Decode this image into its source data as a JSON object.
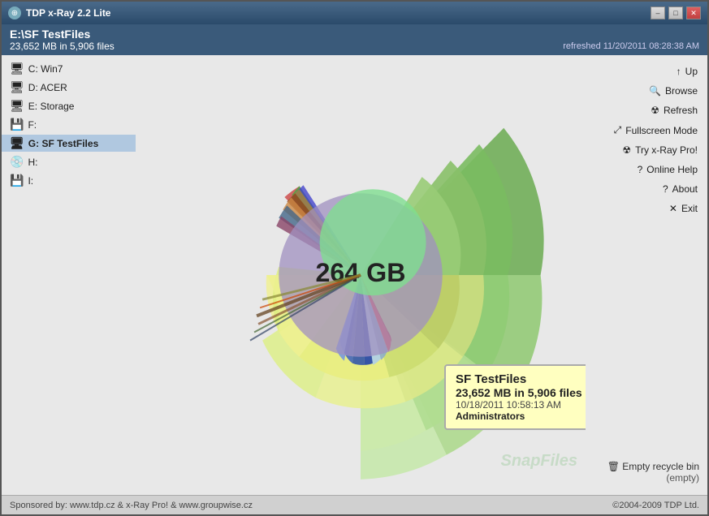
{
  "window": {
    "title": "TDP x-Ray 2.2 Lite",
    "controls": {
      "minimize": "–",
      "maximize": "□",
      "close": "✕"
    }
  },
  "header": {
    "path": "E:\\SF TestFiles",
    "size_info": "23,652 MB in 5,906 files",
    "refresh_time": "refreshed 11/20/2011 08:28:38 AM"
  },
  "drives": [
    {
      "label": "C: Win7",
      "icon_type": "hdd"
    },
    {
      "label": "D: ACER",
      "icon_type": "hdd"
    },
    {
      "label": "E: Storage",
      "icon_type": "hdd"
    },
    {
      "label": "F:",
      "icon_type": "usb"
    },
    {
      "label": "G: SF TestFiles",
      "icon_type": "hdd",
      "selected": true
    },
    {
      "label": "H:",
      "icon_type": "save"
    },
    {
      "label": "I:",
      "icon_type": "usb"
    }
  ],
  "actions": [
    {
      "label": "Up",
      "icon": "↑"
    },
    {
      "label": "Browse",
      "icon": "🔍"
    },
    {
      "label": "Refresh",
      "icon": "☢"
    },
    {
      "label": "Fullscreen Mode",
      "icon": "✕"
    },
    {
      "label": "Try x-Ray Pro!",
      "icon": "☢"
    },
    {
      "label": "Online Help",
      "icon": "?"
    },
    {
      "label": "About",
      "icon": "?"
    },
    {
      "label": "Exit",
      "icon": "✕"
    }
  ],
  "chart": {
    "center_label": "264 GB"
  },
  "tooltip": {
    "title": "SF TestFiles",
    "size": "23,652 MB in 5,906 files",
    "date": "10/18/2011 10:58:13 AM",
    "user": "Administrators"
  },
  "recycle": {
    "icon": "🗑",
    "label": "Empty recycle bin",
    "status": "(empty)"
  },
  "footer": {
    "sponsor": "Sponsored by: www.tdp.cz & x-Ray Pro! & www.groupwise.cz",
    "copyright": "©2004-2009 TDP Ltd."
  },
  "watermark": "SnapFiles"
}
